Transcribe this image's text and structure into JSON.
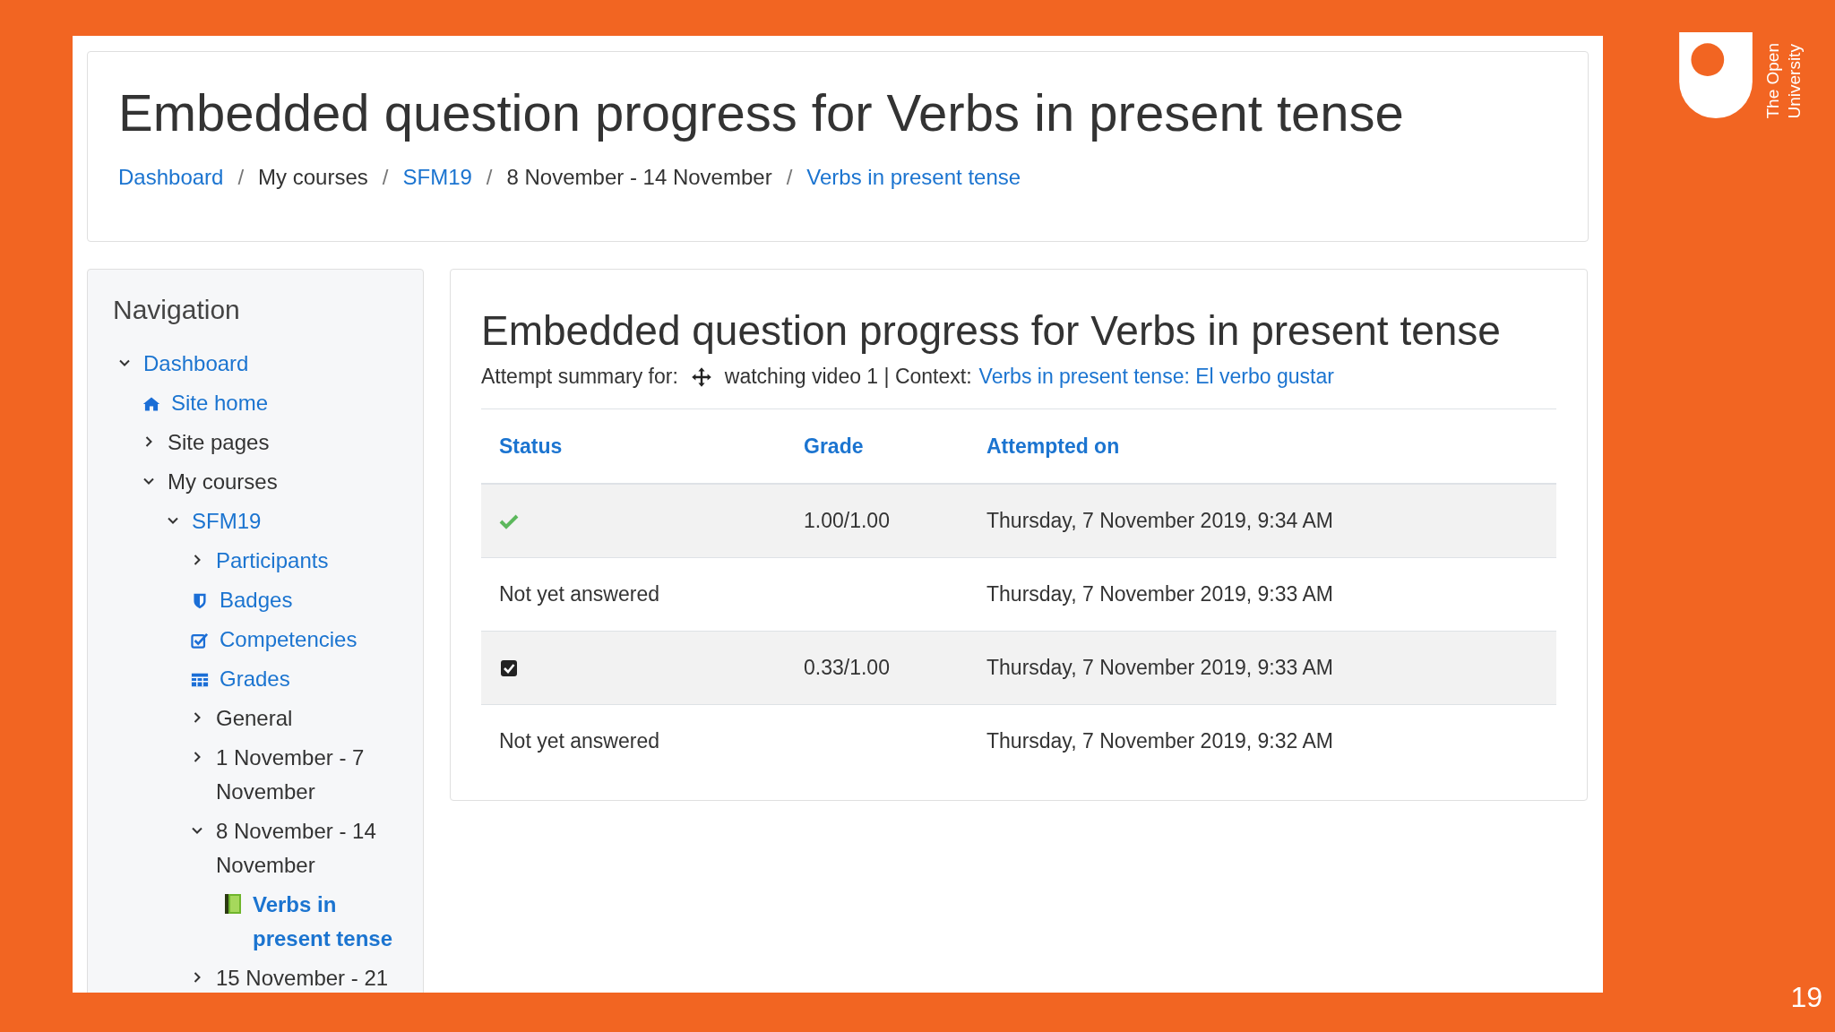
{
  "header": {
    "title": "Embedded question progress for Verbs in present tense",
    "breadcrumb": [
      {
        "kind": "link",
        "text": "Dashboard"
      },
      {
        "kind": "separator",
        "text": "/"
      },
      {
        "kind": "text",
        "text": "My courses"
      },
      {
        "kind": "separator",
        "text": "/"
      },
      {
        "kind": "link",
        "text": "SFM19"
      },
      {
        "kind": "separator",
        "text": "/"
      },
      {
        "kind": "text",
        "text": "8 November - 14 November"
      },
      {
        "kind": "separator",
        "text": "/"
      },
      {
        "kind": "link",
        "text": "Verbs in present tense"
      }
    ]
  },
  "navigation": {
    "title": "Navigation",
    "items": [
      {
        "kind": "node",
        "label": "Dashboard",
        "link": true,
        "expanded": true,
        "current": false,
        "children": [
          {
            "kind": "home",
            "label": "Site home",
            "link": true,
            "current": false
          },
          {
            "kind": "node",
            "label": "Site pages",
            "link": false,
            "expanded": false,
            "current": false
          },
          {
            "kind": "node",
            "label": "My courses",
            "link": false,
            "expanded": true,
            "current": false,
            "children": [
              {
                "kind": "node",
                "label": "SFM19",
                "link": true,
                "expanded": true,
                "current": false,
                "children": [
                  {
                    "kind": "node",
                    "label": "Participants",
                    "link": true,
                    "expanded": false,
                    "current": false
                  },
                  {
                    "kind": "badges",
                    "label": "Badges",
                    "link": true,
                    "current": false
                  },
                  {
                    "kind": "competencies",
                    "label": "Competencies",
                    "link": true,
                    "current": false
                  },
                  {
                    "kind": "grades",
                    "label": "Grades",
                    "link": true,
                    "current": false
                  },
                  {
                    "kind": "node",
                    "label": "General",
                    "link": false,
                    "expanded": false,
                    "current": false
                  },
                  {
                    "kind": "node",
                    "label": "1 November - 7 November",
                    "link": false,
                    "expanded": false,
                    "current": false
                  },
                  {
                    "kind": "node",
                    "label": "8 November - 14 November",
                    "link": false,
                    "expanded": true,
                    "current": false,
                    "children": [
                      {
                        "kind": "activity",
                        "label": "Verbs in present tense",
                        "link": true,
                        "current": true
                      }
                    ]
                  },
                  {
                    "kind": "node",
                    "label": "15 November - 21",
                    "link": false,
                    "expanded": false,
                    "current": false
                  }
                ]
              }
            ]
          }
        ]
      }
    ]
  },
  "main": {
    "title": "Embedded question progress for Verbs in present tense",
    "summary": {
      "label": "Attempt summary for:",
      "user": "watching video 1 | Context:",
      "context_link": "Verbs in present tense: El verbo gustar"
    },
    "table": {
      "columns": [
        "Status",
        "Grade",
        "Attempted on"
      ],
      "rows": [
        {
          "status": {
            "kind": "correct"
          },
          "grade": "1.00/1.00",
          "attempted": "Thursday, 7 November 2019, 9:34 AM"
        },
        {
          "status": {
            "kind": "text",
            "text": "Not yet answered"
          },
          "grade": "",
          "attempted": "Thursday, 7 November 2019, 9:33 AM"
        },
        {
          "status": {
            "kind": "partial"
          },
          "grade": "0.33/1.00",
          "attempted": "Thursday, 7 November 2019, 9:33 AM"
        },
        {
          "status": {
            "kind": "text",
            "text": "Not yet answered"
          },
          "grade": "",
          "attempted": "Thursday, 7 November 2019, 9:32 AM"
        }
      ]
    }
  },
  "slide": {
    "logo_lines": [
      "The Open",
      "University"
    ],
    "page_number": "19"
  }
}
